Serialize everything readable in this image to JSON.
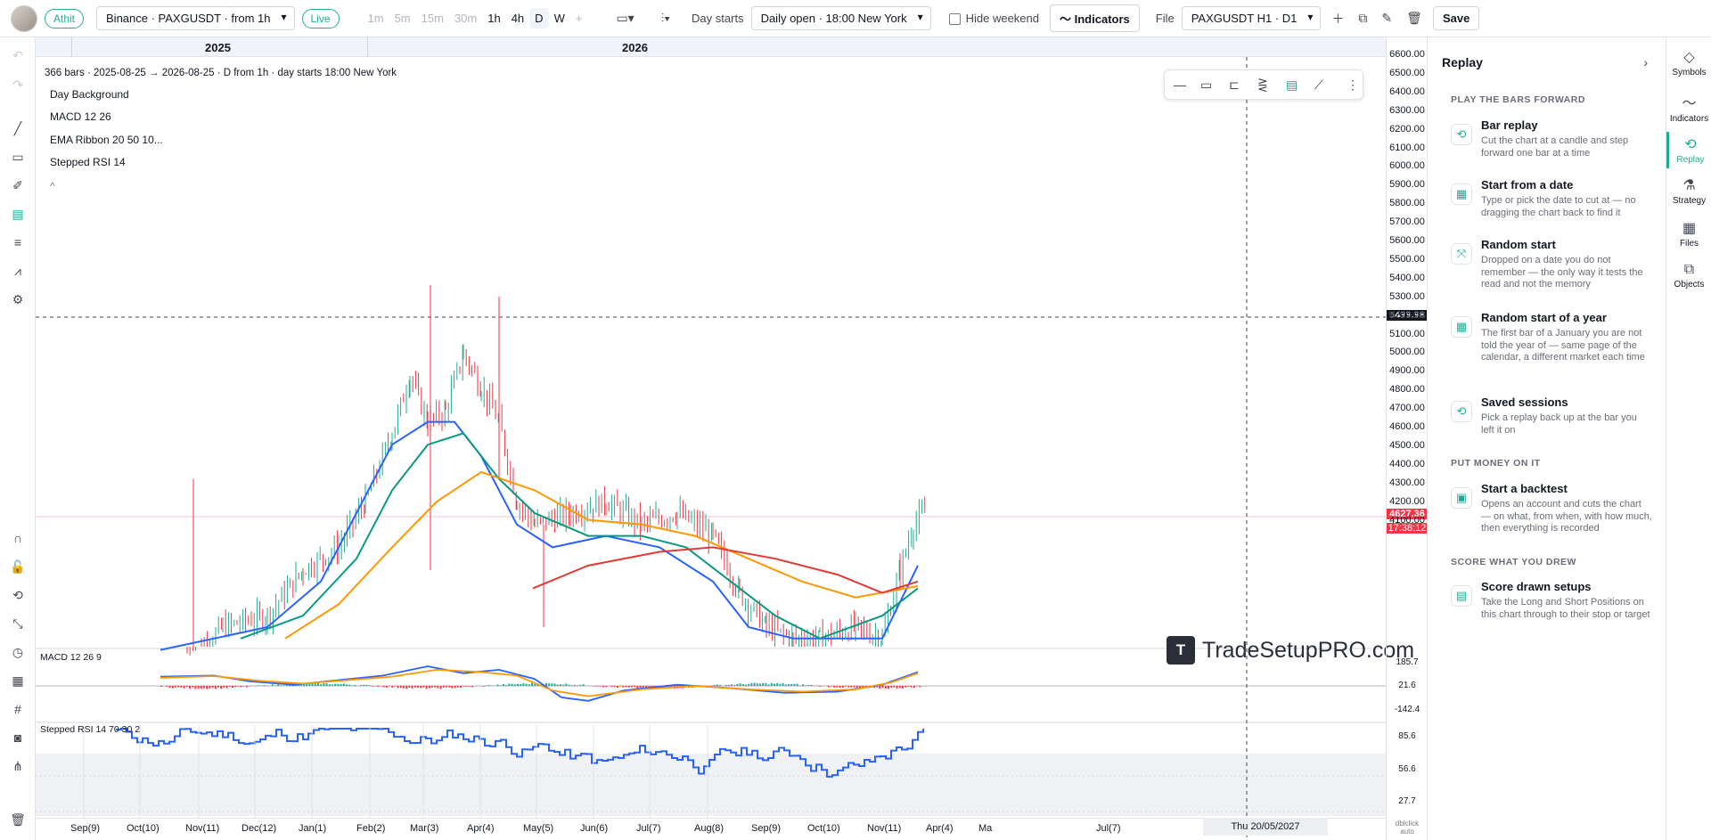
{
  "topbar": {
    "user_chip": "Athit",
    "symbol": "Binance · PAXGUSDT · from 1h",
    "live": "Live",
    "timeframes": [
      "1m",
      "5m",
      "15m",
      "30m",
      "1h",
      "4h",
      "D",
      "W",
      "+"
    ],
    "day_starts_label": "Day starts",
    "day_starts_value": "Daily open · 18:00 New York",
    "hide_weekend": "Hide weekend",
    "indicators": "Indicators",
    "file_label": "File",
    "file_value": "PAXGUSDT H1 · D1",
    "save": "Save"
  },
  "chart": {
    "years": [
      "2025",
      "2026"
    ],
    "info_line": "366 bars · 2025-08-25 → 2026-08-25 · D from 1h · day starts 18:00 New York",
    "indicators": [
      "Day Background",
      "MACD 12 26",
      "EMA Ribbon 20 50 10...",
      "Stepped RSI 14"
    ],
    "collapse": "^",
    "price_ticks": [
      "6600.00",
      "6500.00",
      "6400.00",
      "6300.00",
      "6200.00",
      "6100.00",
      "6000.00",
      "5900.00",
      "5800.00",
      "5700.00",
      "5600.00",
      "5500.00",
      "5400.00",
      "5300.00",
      "5200.00",
      "5100.00",
      "5000.00",
      "4900.00",
      "4800.00",
      "4700.00",
      "4600.00",
      "4500.00",
      "4400.00",
      "4300.00",
      "4200.00",
      "4100.00"
    ],
    "crosshair_price": "5499.98",
    "last_price": "4627.36",
    "countdown": "17:38:12",
    "watermark": "TradeSetupPRO.com",
    "macd_label": "MACD 12 26 9",
    "macd_ticks": [
      "185.7",
      "21.6",
      "-142.4"
    ],
    "rsi_label": "Stepped RSI 14 70 30 2",
    "rsi_ticks": [
      "85.6",
      "56.6",
      "27.7"
    ],
    "x_labels": [
      "Sep(9)",
      "Oct(10)",
      "Nov(11)",
      "Dec(12)",
      "Jan(1)",
      "Feb(2)",
      "Mar(3)",
      "Apr(4)",
      "May(5)",
      "Jun(6)",
      "Jul(7)",
      "Aug(8)",
      "Sep(9)",
      "Oct(10)",
      "Nov(11)",
      "Apr(4)",
      "Ma",
      "Jul(7)"
    ],
    "crosshair_date": "Thu 20/05/2027",
    "axis_corner": [
      "dblclick",
      "auto"
    ]
  },
  "replay": {
    "title": "Replay",
    "close": "›",
    "sections": [
      {
        "label": "PLAY THE BARS FORWARD",
        "items": [
          {
            "title": "Bar replay",
            "desc": "Cut the chart at a candle and step forward one bar at a time",
            "icon": "⟲"
          },
          {
            "title": "Start from a date",
            "desc": "Type or pick the date to cut at — no dragging the chart back to find it",
            "icon": "▦"
          },
          {
            "title": "Random start",
            "desc": "Dropped on a date you do not remember — the only way it tests the read and not the memory",
            "icon": "⤧"
          },
          {
            "title": "Random start of a year",
            "desc": "The first bar of a January you are not told the year of — same page of the calendar, a different market each time",
            "icon": "▦"
          },
          {
            "title": "Saved sessions",
            "desc": "Pick a replay back up at the bar you left it on",
            "icon": "⟲"
          }
        ]
      },
      {
        "label": "PUT MONEY ON IT",
        "items": [
          {
            "title": "Start a backtest",
            "desc": "Opens an account and cuts the chart — on what, from when, with how much, then everything is recorded",
            "icon": "▣"
          }
        ]
      },
      {
        "label": "SCORE WHAT YOU DREW",
        "items": [
          {
            "title": "Score drawn setups",
            "desc": "Take the Long and Short Positions on this chart through to their stop or target",
            "icon": "▤"
          }
        ]
      }
    ]
  },
  "rightbar": [
    "Symbols",
    "Indicators",
    "Replay",
    "Strategy",
    "Files",
    "Objects"
  ],
  "colors": {
    "up": "#22ab94",
    "down": "#f23645",
    "ema20": "#2962ff",
    "ema50": "#089981",
    "ema100": "#ff9800",
    "ema200": "#e53935"
  }
}
